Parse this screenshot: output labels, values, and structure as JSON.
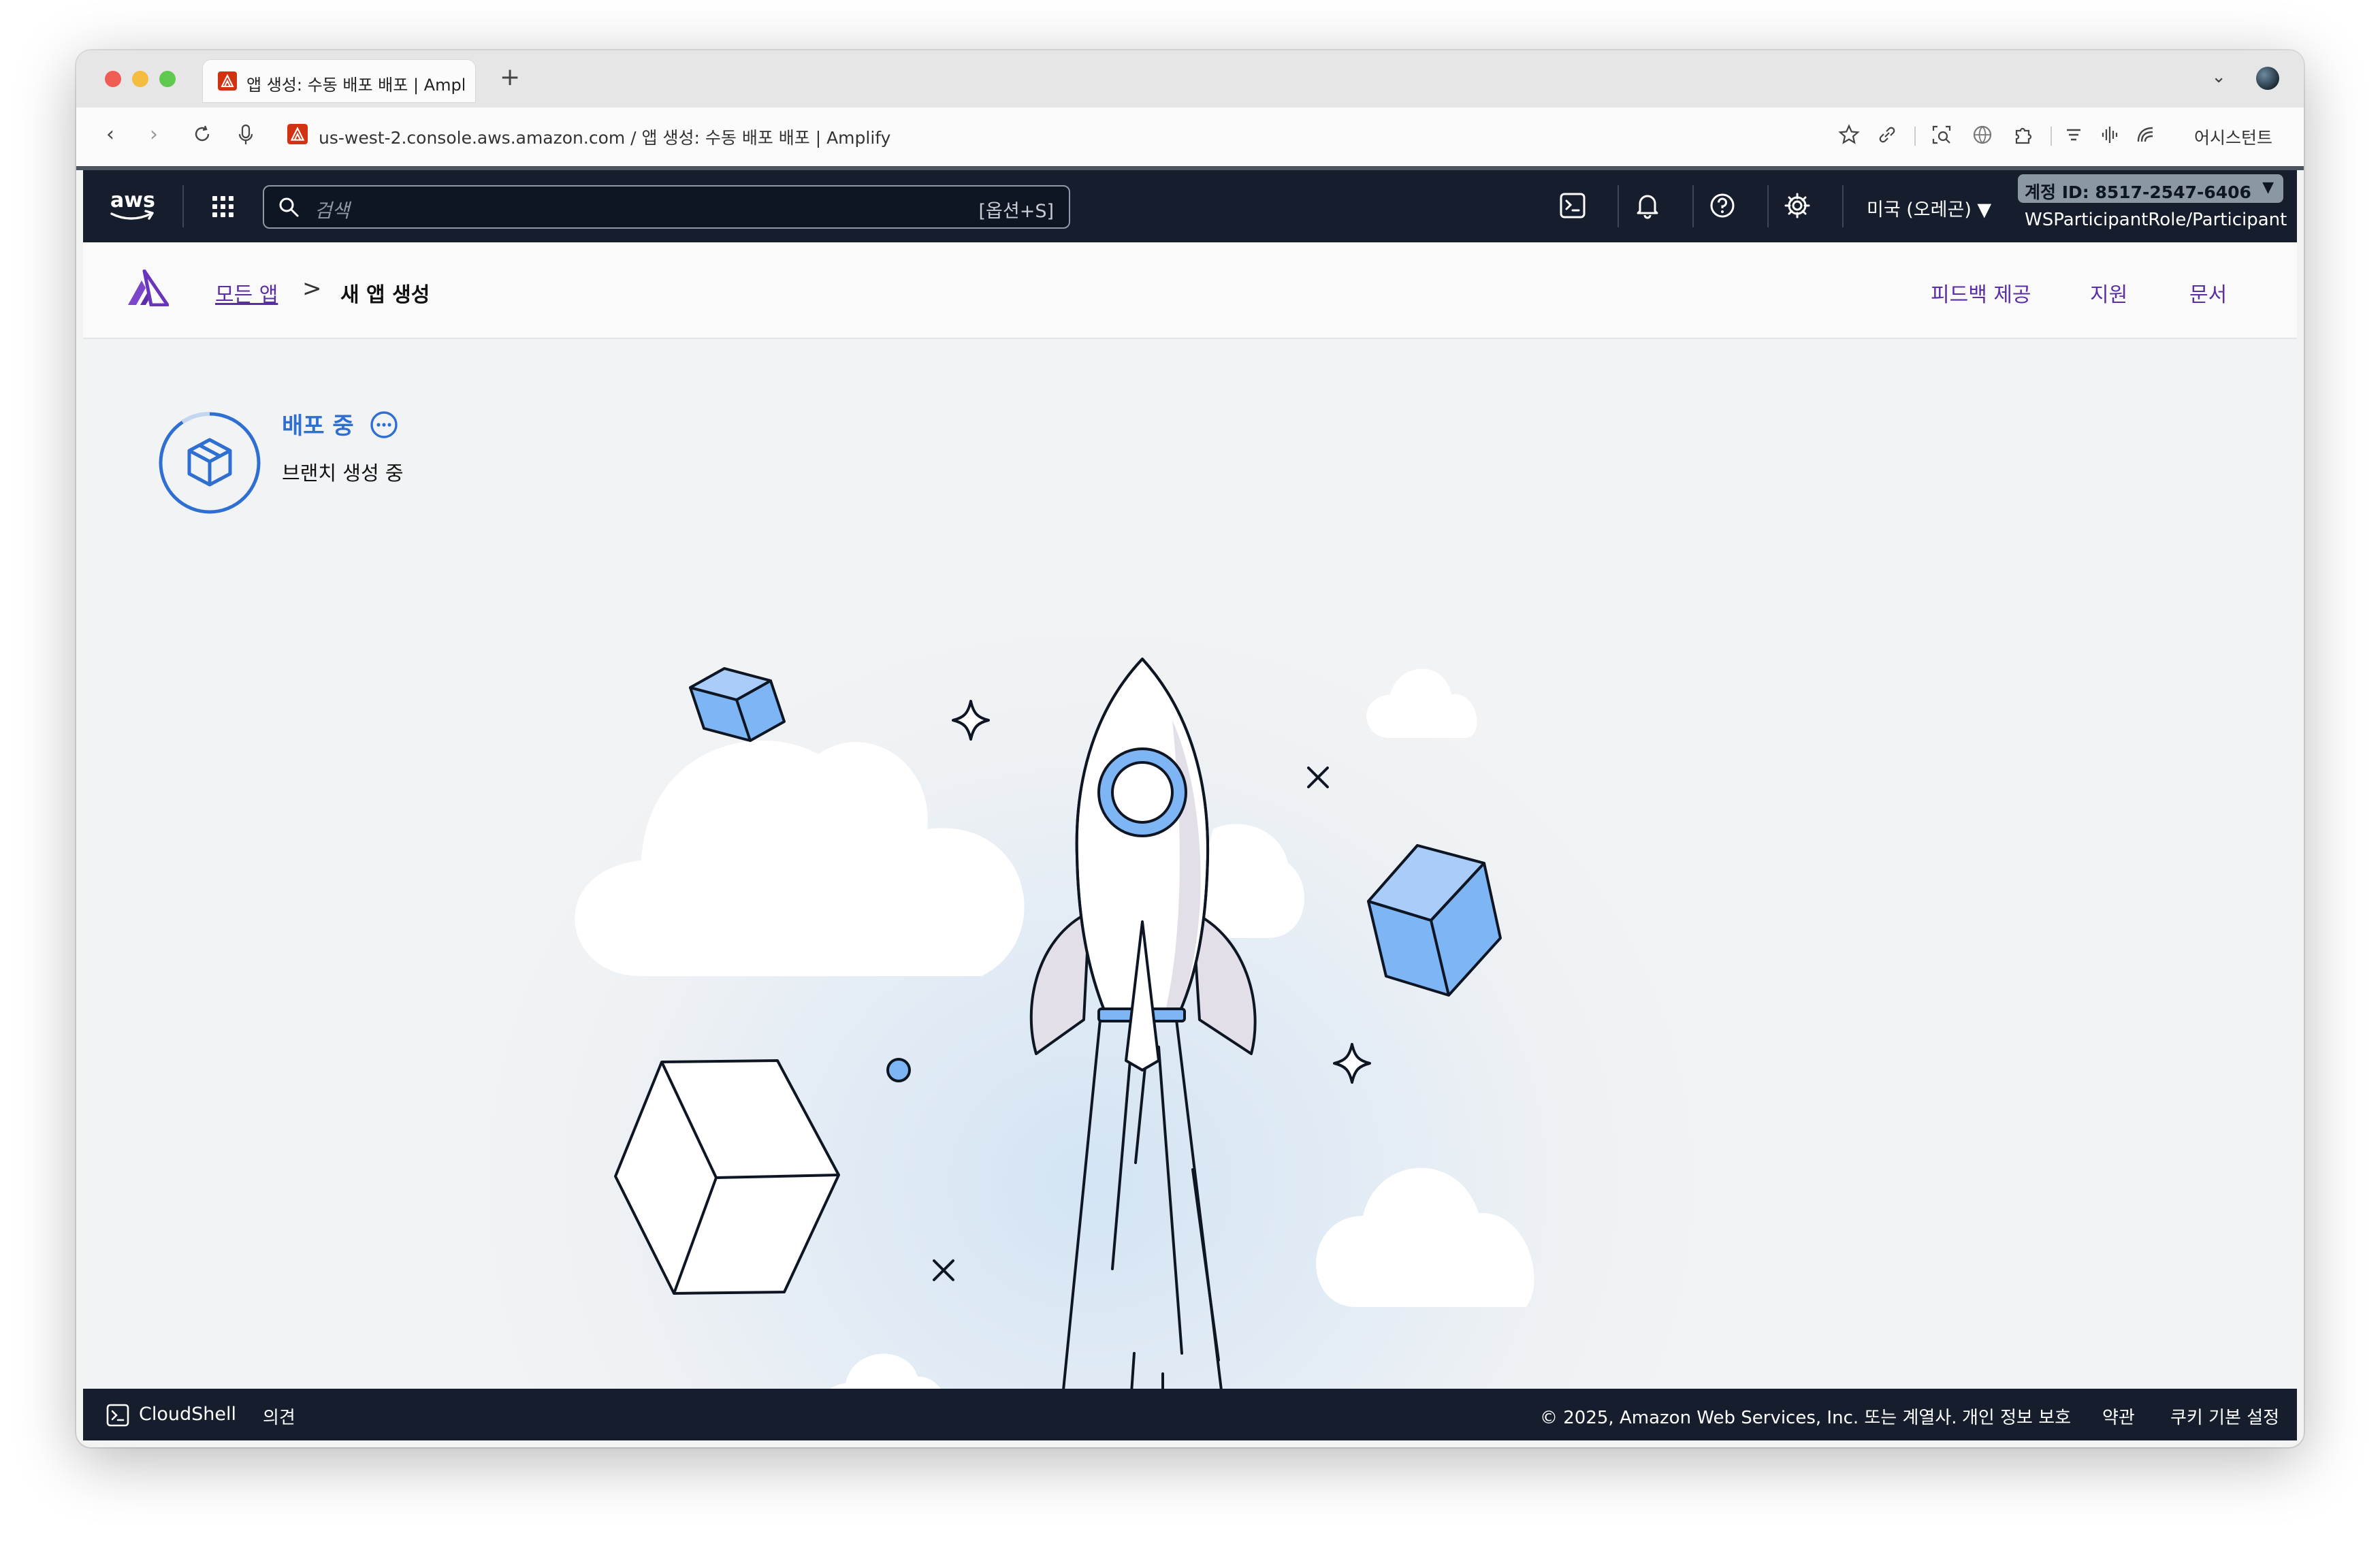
{
  "browser": {
    "tab_title": "앱 생성: 수동 배포 배포 | Amplify",
    "new_tab": "+",
    "url_host": "us-west-2.console.aws.amazon.com",
    "url_path": " / 앱 생성: 수동 배포 배포 | Amplify",
    "assistant_label": "어시스턴트"
  },
  "aws_nav": {
    "search_placeholder": "검색",
    "search_shortcut": "[옵션+S]",
    "region": "미국 (오레곤) ▼",
    "account_id": "계정 ID: 8517-2547-6406",
    "account_arrow": "▼",
    "role": "WSParticipantRole/Participant"
  },
  "breadcrumb": {
    "all_apps": "모든 앱",
    "separator": ">",
    "current": "새 앱 생성"
  },
  "header_links": {
    "feedback": "피드백 제공",
    "support": "지원",
    "docs": "문서"
  },
  "status": {
    "title": "배포 중",
    "subtitle": "브랜치 생성 중"
  },
  "footer": {
    "cloudshell": "CloudShell",
    "feedback": "의견",
    "copyright": "© 2025, Amazon Web Services, Inc. 또는 계열사.",
    "privacy": "개인 정보 보호",
    "terms": "약관",
    "cookies": "쿠키 기본 설정"
  },
  "colors": {
    "aws_nav_bg": "#161e2d",
    "link_purple": "#5a2fa6",
    "status_blue": "#2f6fd1",
    "cube_blue": "#7eb6f5"
  },
  "icons": [
    "aws-logo",
    "apps-grid-icon",
    "search-icon",
    "cloudshell-icon",
    "bell-icon",
    "help-icon",
    "gear-icon",
    "amplify-logo",
    "cube-icon",
    "more-icon",
    "rocket-illustration"
  ]
}
